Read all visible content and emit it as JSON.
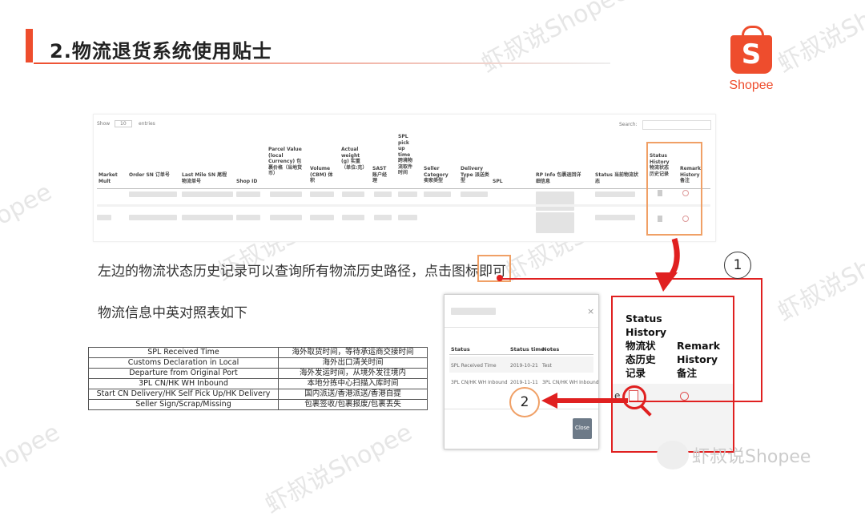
{
  "header": {
    "title": "2.物流退货系统使用贴士"
  },
  "logo": {
    "glyph": "S",
    "text": "Shopee"
  },
  "watermark": {
    "text": "虾叔说Shopee",
    "bottom_text": "虾叔说Shopee"
  },
  "order_table": {
    "show_label": "Show",
    "show_value": "10",
    "entries_label": "entries",
    "search_label": "Search:",
    "headers": [
      "Market Mult",
      "Order SN 订单号",
      "Last Mile SN 尾程物流单号",
      "Shop ID",
      "Parcel Value (local Currency) 包裹价格（当地货币）",
      "Volume (CBM) 体积",
      "Actual weight (g) 实重（单位:克）",
      "SAST 账户经理",
      "SPL pick up time 跨境物流取件时间",
      "Seller Category 卖家类型",
      "Delivery Type 派送类型",
      "SPL",
      "RP Info 包裹退回详细信息",
      "Status 当前物流状态",
      "Status History 物流状态历史记录",
      "Remark History 备注"
    ]
  },
  "instructions": {
    "line1": "左边的物流状态历史记录可以查询所有物流历史路径，点击图标即可",
    "line2": "物流信息中英对照表如下"
  },
  "mapping_table": [
    {
      "en": "SPL Received Time",
      "cn": "海外取货时间，等待承运商交接时间"
    },
    {
      "en": "Customs Declaration in Local",
      "cn": "海外出口清关时间"
    },
    {
      "en": "Departure from Original Port",
      "cn": "海外发运时间，从境外发往境内"
    },
    {
      "en": "3PL CN/HK WH Inbound",
      "cn": "本地分拣中心扫描入库时间"
    },
    {
      "en": "Start CN Delivery/HK Self Pick Up/HK Delivery",
      "cn": "国内派送/香港派送/香港自提"
    },
    {
      "en": "Seller Sign/Scrap/Missing",
      "cn": "包裹签收/包裹报废/包裹丢失"
    }
  ],
  "modal": {
    "close_x": "×",
    "columns": [
      "Status",
      "Status time",
      "Notes"
    ],
    "rows": [
      {
        "status": "SPL Received Time",
        "time": "2019-10-21",
        "notes": "Test"
      },
      {
        "status": "3PL CN/HK WH Inbound",
        "time": "2019-11-11",
        "notes": "3PL CN/HK WH Inbound"
      }
    ],
    "close_label": "Close"
  },
  "zoom_panel": {
    "status_history": "Status\nHistory\n物流状\n态历史\n记录",
    "remark_history": "Remark\nHistory\n备注",
    "partial": "e"
  },
  "callouts": {
    "one": "1",
    "two": "2"
  },
  "colors": {
    "accent": "#ee4d2d",
    "highlight": "#e02020",
    "box": "#f0a066"
  }
}
